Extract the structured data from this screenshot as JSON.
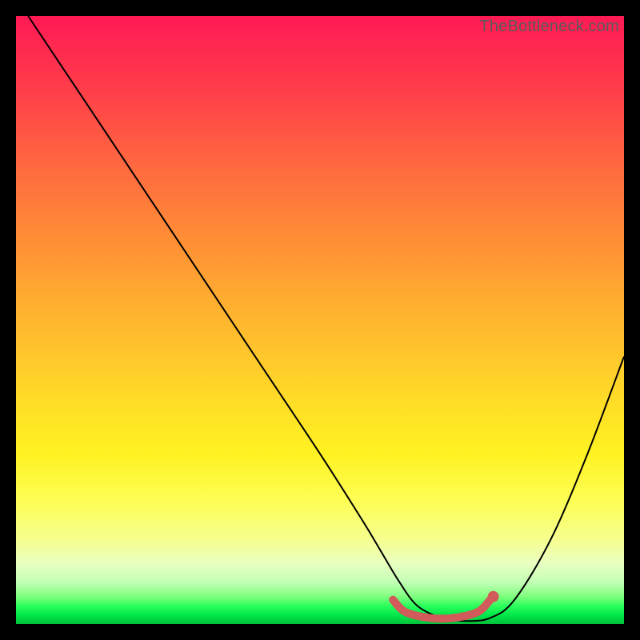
{
  "watermark": "TheBottleneck.com",
  "chart_data": {
    "type": "line",
    "title": "",
    "xlabel": "",
    "ylabel": "",
    "xlim": [
      0,
      100
    ],
    "ylim": [
      0,
      100
    ],
    "grid": false,
    "series": [
      {
        "name": "bottleneck-curve",
        "color": "#000000",
        "stroke_width": 2,
        "x": [
          2,
          10,
          20,
          30,
          40,
          50,
          57,
          60,
          63,
          66,
          70,
          74,
          78,
          82,
          88,
          94,
          100
        ],
        "y": [
          100,
          88,
          73,
          58,
          43,
          28,
          17,
          12,
          7,
          3,
          1,
          0.5,
          1,
          4,
          14,
          28,
          44
        ]
      },
      {
        "name": "optimal-region",
        "color": "#d15a5a",
        "stroke_width": 10,
        "linecap": "round",
        "x": [
          62,
          64,
          68,
          72,
          76,
          78
        ],
        "y": [
          4,
          2,
          1,
          1,
          2,
          4
        ]
      }
    ],
    "markers": [
      {
        "name": "optimal-end-dot",
        "x": 78.5,
        "y": 4.5,
        "r": 7,
        "color": "#d15a5a"
      }
    ]
  }
}
